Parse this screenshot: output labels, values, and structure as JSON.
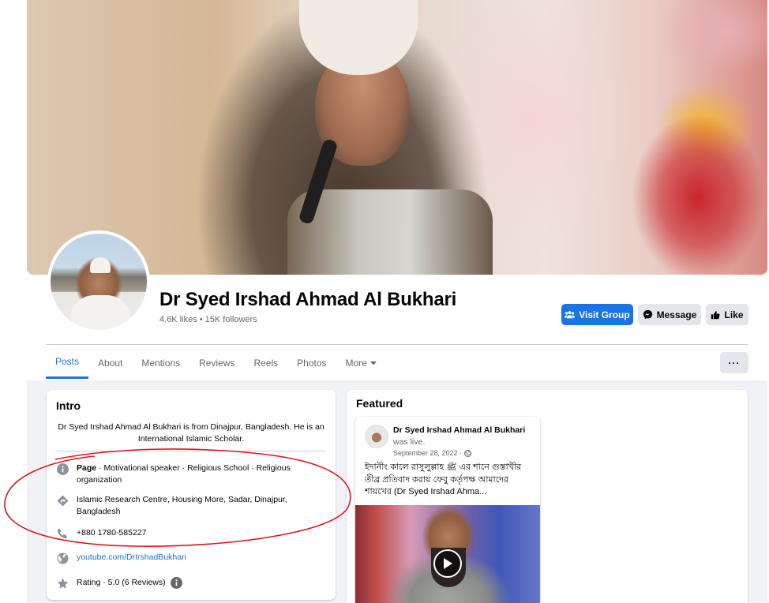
{
  "profile": {
    "name": "Dr Syed Irshad Ahmad Al Bukhari",
    "stats": "4.6K likes • 15K followers"
  },
  "actions": {
    "visit_group": "Visit Group",
    "message": "Message",
    "like": "Like",
    "more": "···"
  },
  "tabs": [
    {
      "label": "Posts"
    },
    {
      "label": "About"
    },
    {
      "label": "Mentions"
    },
    {
      "label": "Reviews"
    },
    {
      "label": "Reels"
    },
    {
      "label": "Photos"
    },
    {
      "label": "More"
    }
  ],
  "intro": {
    "title": "Intro",
    "bio": "Dr Syed Irshad Ahmad Al Bukhari is from Dinajpur, Bangladesh. He is an International Islamic Scholar.",
    "page_label": "Page",
    "page_categories": " · Motivational speaker · Religious School · Religious organization",
    "address": "Islamic Research Centre, Housing More, Sadar, Dinajpur, Bangladesh",
    "phone": "+880 1780-585227",
    "website": "youtube.com/DrIrshadBukhari",
    "rating": "Rating · 5.0 (6 Reviews)"
  },
  "featured": {
    "title": "Featured",
    "post": {
      "author": "Dr Syed Irshad Ahmad Al Bukhari",
      "status": "was live.",
      "date": "September 28, 2022 ·",
      "text": "ইদানীং কালে রাসুলুল্লাহ ﷺ এর শানে গুস্তাখীর তীব্র প্রতিবাদ করায় ফেবু কর্তৃপক্ষ আমাদের শায়খের (Dr Syed Irshad Ahma..."
    }
  },
  "colors": {
    "accent": "#1b74e4",
    "annotation": "#e0141e"
  },
  "icons": {
    "info": "info-icon",
    "directions": "directions-icon",
    "phone": "phone-icon",
    "globe": "globe-icon",
    "star": "star-icon"
  }
}
